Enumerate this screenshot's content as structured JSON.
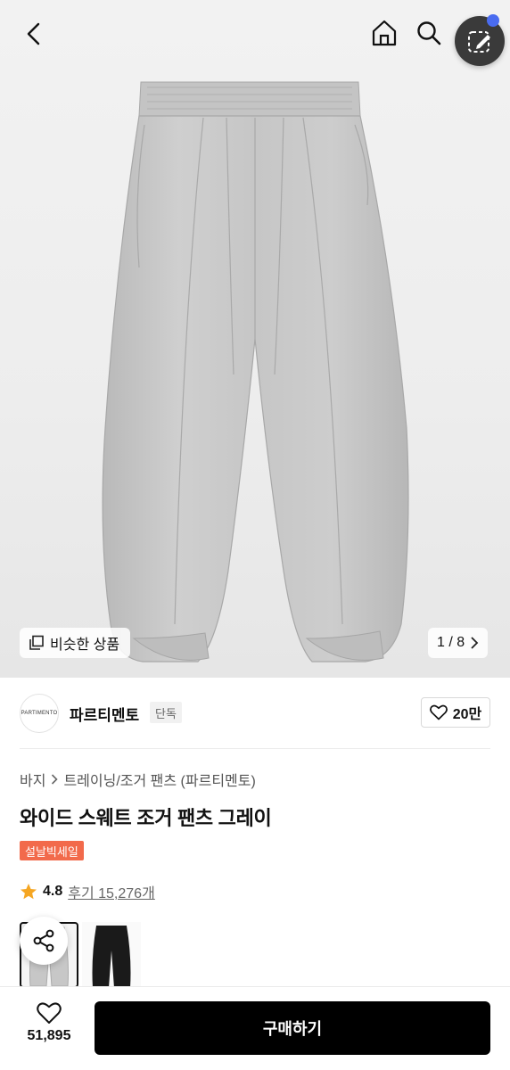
{
  "header": {
    "icons": [
      "back-arrow-icon",
      "home-icon",
      "search-icon",
      "edit-select-icon"
    ]
  },
  "gallery": {
    "similar_label": "비슷한 상품",
    "page_indicator": "1 / 8"
  },
  "brand": {
    "logo_text": "PARTIMENTO",
    "name": "파르티멘토",
    "tag": "단독",
    "like_count": "20만"
  },
  "product": {
    "breadcrumb_category": "바지",
    "breadcrumb_subcategory": "트레이닝/조거 팬츠 (파르티멘토)",
    "title": "와이드 스웨트 조거 팬츠 그레이",
    "sale_badge": "설날빅세일",
    "rating": "4.8",
    "review_label": "후기 15,276개"
  },
  "colors": {
    "accent_sale": "#f26a4b",
    "star": "#f5a623",
    "primary_button": "#000000"
  },
  "bottom_bar": {
    "wish_count": "51,895",
    "buy_label": "구매하기"
  }
}
